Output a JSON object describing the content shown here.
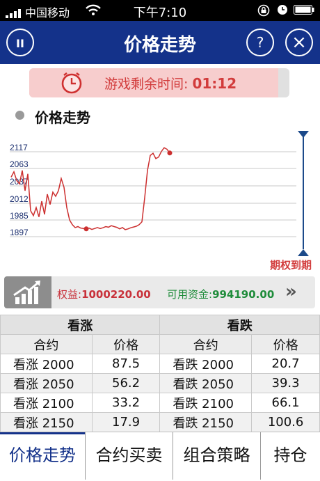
{
  "status_bar": {
    "carrier": "中国移动",
    "time": "下午7:10"
  },
  "nav": {
    "title": "价格走势",
    "pause_label": "II",
    "help_label": "?",
    "close_label": "×"
  },
  "timer": {
    "label": "游戏剩余时间: ",
    "value": "01:12"
  },
  "chart_section": {
    "title": "价格走势"
  },
  "chart_data": {
    "type": "line",
    "y_ticks": [
      "2117",
      "2063",
      "2037",
      "2012",
      "1985",
      "1897"
    ],
    "y_ticks_values": [
      2117,
      2063,
      2037,
      2012,
      1985,
      1897
    ],
    "expiry_label": "期权到期",
    "series": [
      {
        "values": [
          2050,
          2058,
          2045,
          2040,
          2060,
          2030,
          2055,
          2000,
          1992,
          2005,
          1990,
          2015,
          1994,
          2025,
          2010,
          2028,
          2022,
          2030,
          2048,
          2035,
          2005,
          1985,
          1960,
          1945,
          1950,
          1942,
          1940,
          1938,
          1942,
          1935,
          1940,
          1945,
          1940,
          1944,
          1950,
          1947,
          1955,
          1950,
          1946,
          1938,
          1945,
          1934,
          1938,
          1944,
          1948,
          1952,
          1960,
          1975,
          2020,
          2060,
          2105,
          2112,
          2095,
          2100,
          2118,
          2130,
          2125,
          2113
        ]
      }
    ],
    "markers": [
      {
        "index": 27,
        "value": 1938
      },
      {
        "index": 57,
        "value": 2113
      }
    ],
    "colors": {
      "line": "#cc2f2f",
      "expiry_line": "#1c4a8a"
    }
  },
  "account": {
    "equity_label": "权益:",
    "equity_value": "1000220.00",
    "funds_label": "可用资金:",
    "funds_value": "994190.00",
    "more_label": "»"
  },
  "table": {
    "call_header": "看涨",
    "put_header": "看跌",
    "col_contract": "合约",
    "col_price": "价格",
    "rows": [
      {
        "call": "看涨 2000",
        "call_price": "87.5",
        "put": "看跌 2000",
        "put_price": "20.7"
      },
      {
        "call": "看涨 2050",
        "call_price": "56.2",
        "put": "看跌 2050",
        "put_price": "39.3"
      },
      {
        "call": "看涨 2100",
        "call_price": "33.2",
        "put": "看跌 2100",
        "put_price": "66.1"
      },
      {
        "call": "看涨 2150",
        "call_price": "17.9",
        "put": "看跌 2150",
        "put_price": "100.6"
      }
    ]
  },
  "tabs": [
    {
      "label": "价格走势",
      "active": true
    },
    {
      "label": "合约买卖",
      "active": false
    },
    {
      "label": "组合策略",
      "active": false
    },
    {
      "label": "持仓",
      "active": false
    }
  ]
}
